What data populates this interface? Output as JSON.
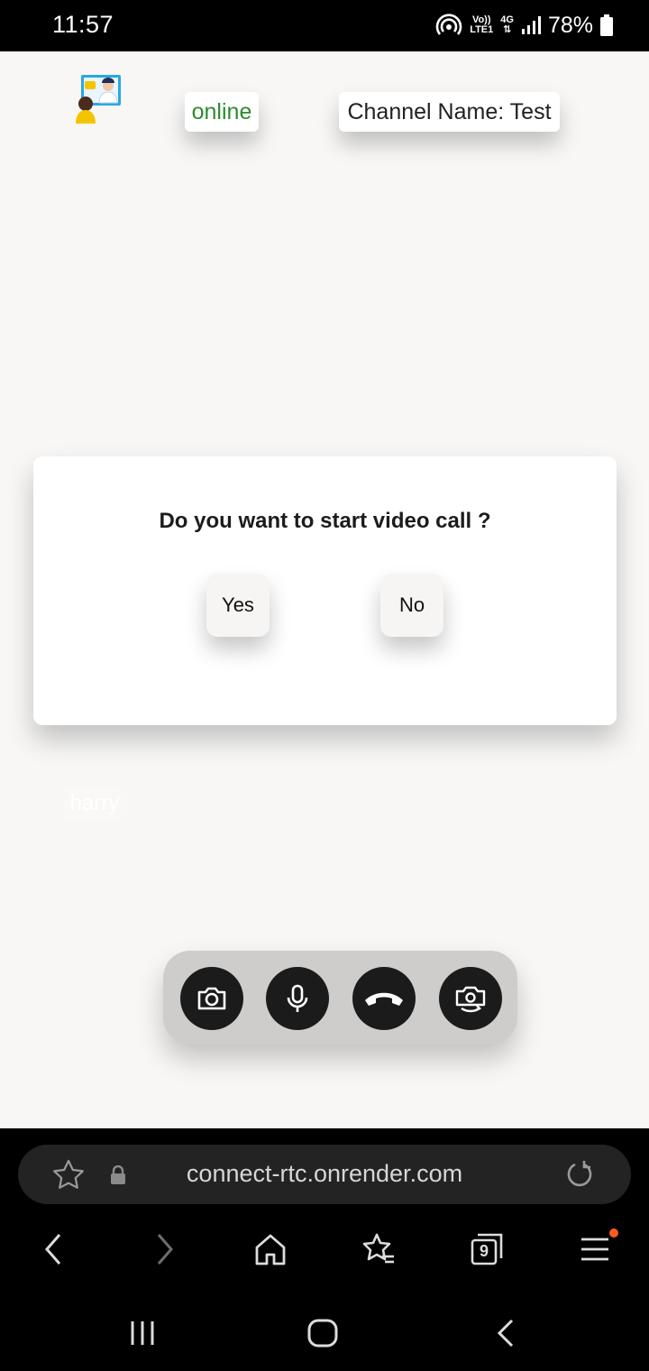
{
  "status_bar": {
    "time": "11:57",
    "volte": "Vo))",
    "lte": "LTE1",
    "network": "4G",
    "battery": "78%"
  },
  "app": {
    "logo_icon": "video-call-logo-icon",
    "status": "online",
    "channel": "Channel Name: Test",
    "ghost_name": "harry"
  },
  "dialog": {
    "title": "Do you want to start video call ?",
    "yes_label": "Yes",
    "no_label": "No"
  },
  "controls": [
    {
      "icon": "camera-icon"
    },
    {
      "icon": "microphone-icon"
    },
    {
      "icon": "hang-up-icon"
    },
    {
      "icon": "switch-camera-icon"
    }
  ],
  "browser": {
    "url": "connect-rtc.onrender.com",
    "tab_count": "9",
    "icons": [
      "star-icon",
      "lock-icon",
      "reload-icon",
      "back-icon",
      "forward-icon",
      "home-icon",
      "bookmarks-icon",
      "tabs-icon",
      "menu-icon"
    ]
  },
  "colors": {
    "online_green": "#2e8b2e",
    "notification_dot": "#ff5a1f"
  }
}
